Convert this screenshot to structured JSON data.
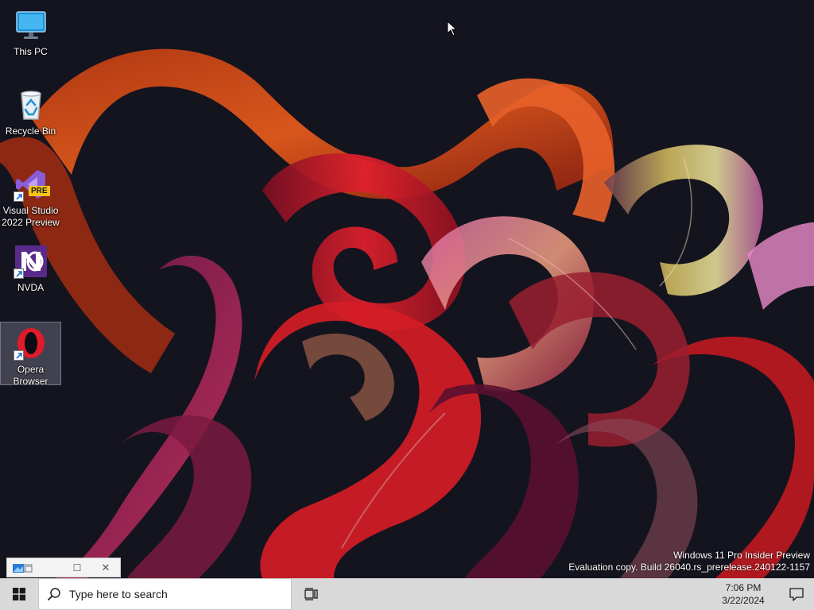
{
  "desktop": {
    "icons": [
      {
        "label": "This PC"
      },
      {
        "label": "Recycle Bin"
      },
      {
        "label": "Visual Studio 2022 Preview",
        "badge": "PRE"
      },
      {
        "label": "NVDA"
      },
      {
        "label": "Opera Browser"
      }
    ],
    "watermark": {
      "line1": "Windows 11 Pro Insider Preview",
      "line2": "Evaluation copy. Build 26040.rs_prerelease.240122-1157"
    }
  },
  "mini_window": {
    "minimize": "",
    "maximize": "☐",
    "close": "✕"
  },
  "taskbar": {
    "search_placeholder": "Type here to search",
    "time": "7:06 PM",
    "date": "3/22/2024"
  },
  "icons": {
    "start": "windows-logo-icon",
    "search": "search-icon",
    "task_view": "task-view-icon",
    "notifications": "notification-icon"
  },
  "colors": {
    "taskbar_bg": "#d9d9d9",
    "desktop_bg": "#12121c",
    "ribbon_orange": "#e0561e",
    "ribbon_red": "#c81a28",
    "ribbon_pink": "#d8609a"
  }
}
